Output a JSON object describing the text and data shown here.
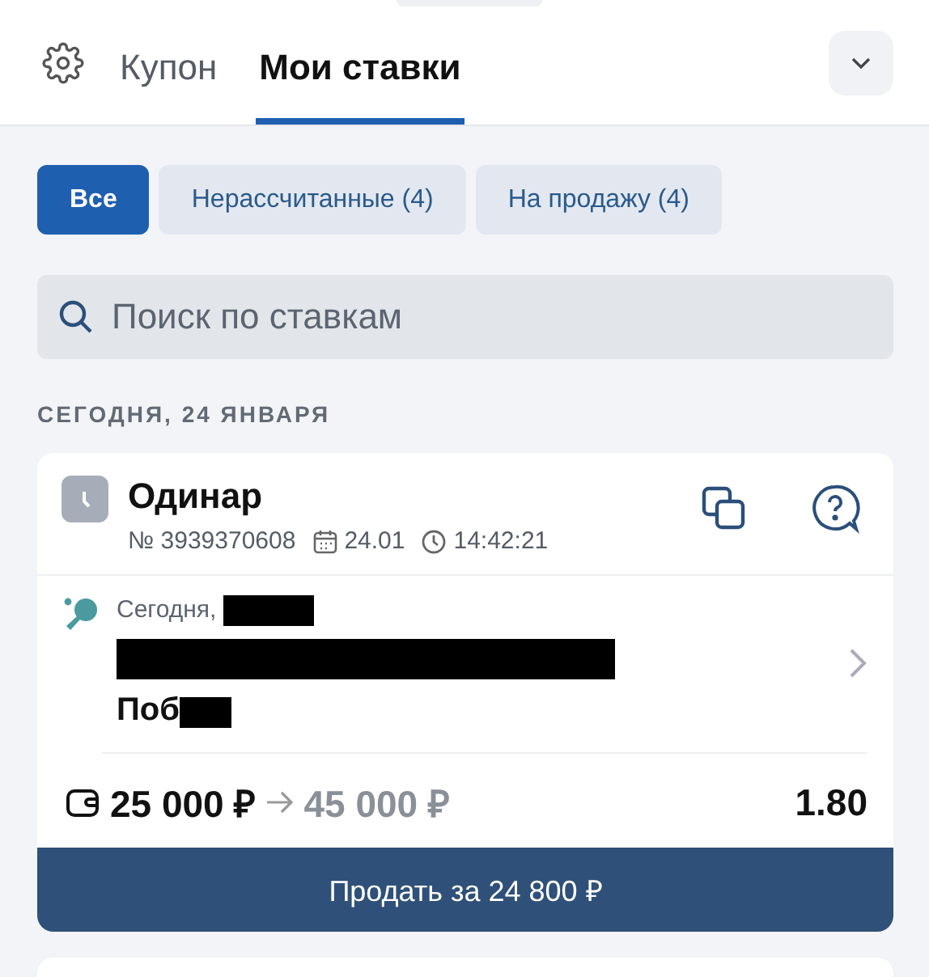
{
  "tabs": [
    {
      "label": "Купон",
      "selected": false
    },
    {
      "label": "Мои ставки",
      "selected": true
    }
  ],
  "filters": [
    {
      "label": "Все",
      "selected": true
    },
    {
      "label": "Нерассчитанные (4)",
      "selected": false
    },
    {
      "label": "На продажу (4)",
      "selected": false
    }
  ],
  "search": {
    "placeholder": "Поиск по ставкам"
  },
  "section_title": "СЕГОДНЯ, 24 ЯНВАРЯ",
  "bet": {
    "type": "Одинар",
    "number": "№ 3939370608",
    "date": "24.01",
    "time": "14:42:21",
    "event_date": "Сегодня,",
    "outcome": "Поб",
    "stake": "25 000 ₽",
    "payout": "45 000 ₽",
    "odds": "1.80",
    "sell_button": "Продать за 24 800 ₽"
  }
}
